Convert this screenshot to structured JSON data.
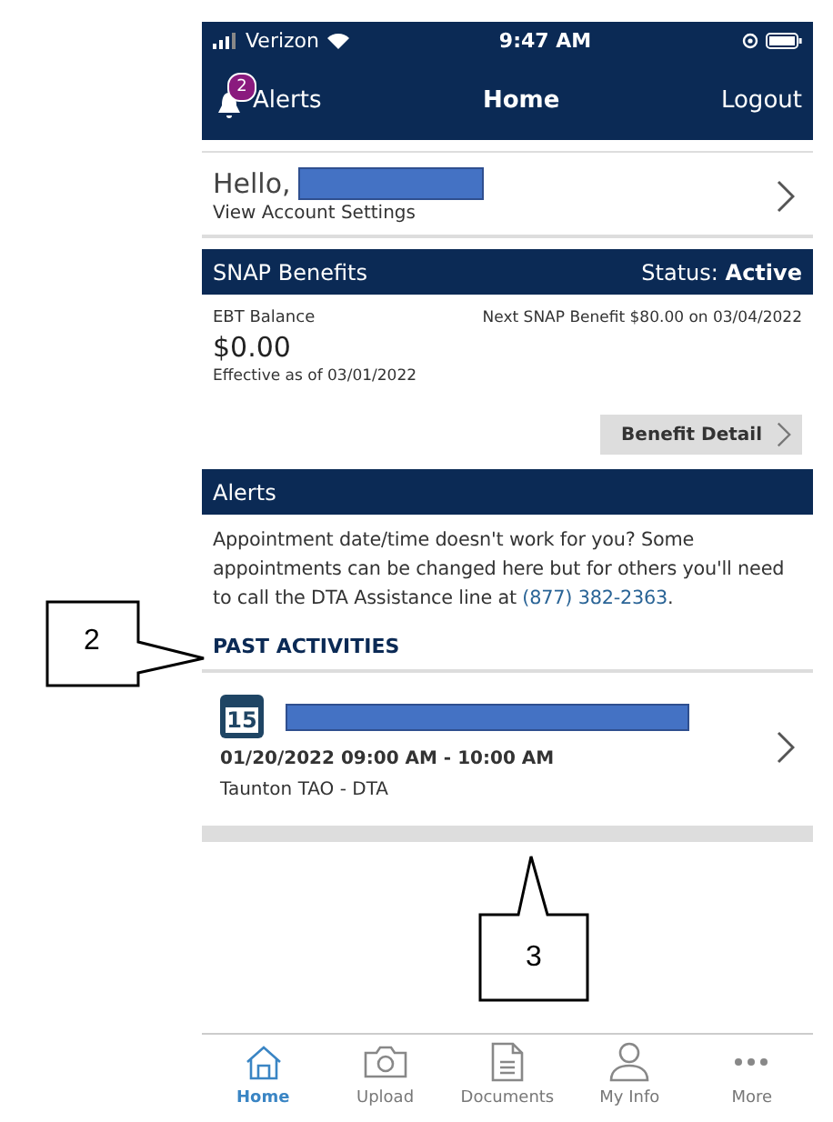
{
  "status_bar": {
    "carrier": "Verizon",
    "time": "9:47 AM"
  },
  "nav_bar": {
    "alerts_label": "Alerts",
    "alerts_count": "2",
    "title": "Home",
    "action": "Logout"
  },
  "greeting": {
    "text": "Hello,",
    "link": "View Account Settings"
  },
  "snap_benefits": {
    "title": "SNAP Benefits",
    "status_label": "Status:",
    "status_value": "Active",
    "balance_label": "EBT Balance",
    "balance": "$0.00",
    "effective": "Effective as of 03/01/2022",
    "next_benefit": "Next SNAP Benefit $80.00 on 03/04/2022",
    "detail_button": "Benefit Detail"
  },
  "alerts": {
    "title": "Alerts",
    "message": "Appointment date/time doesn't work for you? Some appointments can be changed here but for others you'll need to call the DTA Assistance line at ",
    "phone": "(877) 382-2363",
    "message_end": "."
  },
  "past_activities": {
    "title": "PAST ACTIVITIES",
    "items": [
      {
        "calendar_day": "15",
        "time": "01/20/2022 09:00 AM - 10:00 AM",
        "location": "Taunton TAO - DTA"
      }
    ]
  },
  "tab_bar": [
    {
      "label": "Home",
      "kind": "home",
      "selected": true
    },
    {
      "label": "Upload",
      "kind": "camera",
      "selected": false
    },
    {
      "label": "Documents",
      "kind": "document",
      "selected": false
    },
    {
      "label": "My Info",
      "kind": "person",
      "selected": false
    },
    {
      "label": "More",
      "kind": "more",
      "selected": false
    }
  ],
  "callouts": [
    {
      "label": "2",
      "kind": "left"
    },
    {
      "label": "3",
      "kind": "up"
    }
  ]
}
